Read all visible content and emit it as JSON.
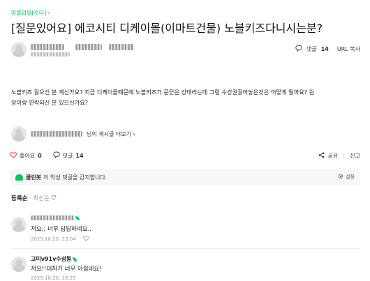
{
  "breadcrumb": {
    "label": "맘블맘요[수다]",
    "chevron": "›"
  },
  "post": {
    "title": "[질문있어요] 에코시티 디케이몰(이마트건물) 노블키즈다니시는분?",
    "comment_label": "댓글",
    "comment_count": "14",
    "url_copy": "URL 복사",
    "body_line1": "노블키즈 잘으신 분 계신가요? 지금 디케이몰때문에 노블키즈가 문닫은 상태라는데 그럼 수강권잘어놓은것은 어떻게 될까요? 원",
    "body_line2": "장이랑 연락되신 분 있으신가요?",
    "profile_link": "님의 게시글 더보기 ›"
  },
  "actions": {
    "like_label": "좋아요",
    "like_count": "0",
    "comment_label": "댓글",
    "comment_count": "14",
    "share_label": "공유",
    "report_label": "신고"
  },
  "cleanbot": {
    "name": "클린봇",
    "message": "이 악성 댓글을 감지합니다.",
    "settings_label": "설정"
  },
  "sort": {
    "registered": "등록순",
    "latest": "최신순"
  },
  "comments": [
    {
      "name": "",
      "text": "저요;; 너무 답답하네요..",
      "date": "2025.10.20. 13:04"
    },
    {
      "name": "고미v91v수성동",
      "text": "저요!!대처가 너무 아쉽네요!",
      "date": "2025.10.20. 15:25"
    }
  ],
  "colors": {
    "accent": "#03c75a",
    "heart": "#ff3b30"
  }
}
